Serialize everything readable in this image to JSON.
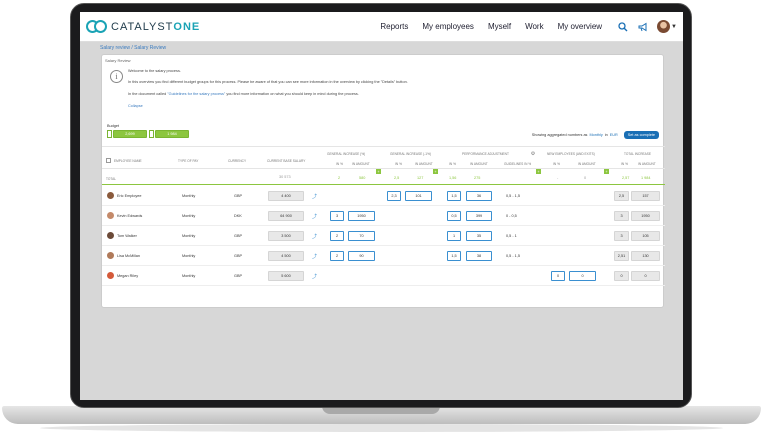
{
  "nav": {
    "brand_a": "CATALYST",
    "brand_b": "ONE",
    "links": [
      "Reports",
      "My employees",
      "Myself",
      "Work",
      "My overview"
    ]
  },
  "breadcrumb": "Salary review / Salary Review",
  "card": {
    "title": "Salary Review",
    "msg1": "Welcome to the salary process.",
    "msg2": "In this overview you find different budget groups for this process. Please be aware of that you can see more information in the overview by clicking the \"Details\" button.",
    "msg3a": "In the document called ",
    "msg3link": "\"Guidelines for the salary process\"",
    "msg3b": " you find more information on what you should keep in mind during the process.",
    "collapse": "Collapse"
  },
  "budget": {
    "label": "Budget",
    "items": [
      "2,699",
      "1 984"
    ]
  },
  "aggregate": {
    "prefix": "Showing aggregated numbers as",
    "period": "Monthly",
    "in": "in",
    "currency": "EUR",
    "button": "Set as complete"
  },
  "columns": {
    "employee": "Employee name",
    "type": "Type of pay",
    "currency": "Currency",
    "base": "Current base salary",
    "general1": "General increase (%)",
    "general2": "General increase (-1%)",
    "performance": "Performance adjustment",
    "newemp": "New employees (and exits)",
    "total": "Total increase",
    "pct": "In %",
    "amount": "In amount",
    "guidelines": "Guidelines in %"
  },
  "totals": {
    "label": "Total",
    "base": "30 573",
    "g1pct": "2",
    "g1amt": "580",
    "g2pct": "2,5",
    "g2amt": "127",
    "perfpct": "1,56",
    "perfamt": "275",
    "newpct": "-",
    "newamt": "0",
    "totpct": "2,57",
    "totamt": "1 984"
  },
  "rows": [
    {
      "name": "Eric Employee",
      "type": "Monthly",
      "currency": "GBP",
      "base": "4 400",
      "g1pct": "",
      "g1amt": "",
      "g2pct": "2,3",
      "g2amt": "101",
      "perfpct": "1,5",
      "perfamt": "36",
      "guide": "0,5 - 1,5",
      "newpct": "",
      "newamt": "",
      "totpct": "2,5",
      "totamt": "157"
    },
    {
      "name": "Kevin Edwards",
      "type": "Monthly",
      "currency": "DKK",
      "base": "64 900",
      "g1pct": "3",
      "g1amt": "1950",
      "g2pct": "",
      "g2amt": "",
      "perfpct": "0,5",
      "perfamt": "399",
      "guide": "0 - 0,5",
      "newpct": "",
      "newamt": "",
      "totpct": "3",
      "totamt": "1950"
    },
    {
      "name": "Tom Walker",
      "type": "Monthly",
      "currency": "GBP",
      "base": "3 500",
      "g1pct": "2",
      "g1amt": "70",
      "g2pct": "",
      "g2amt": "",
      "perfpct": "1",
      "perfamt": "35",
      "guide": "0,5 - 1",
      "newpct": "",
      "newamt": "",
      "totpct": "3",
      "totamt": "105"
    },
    {
      "name": "Lisa McMillan",
      "type": "Monthly",
      "currency": "GBP",
      "base": "4 500",
      "g1pct": "2",
      "g1amt": "90",
      "g2pct": "",
      "g2amt": "",
      "perfpct": "1,5",
      "perfamt": "38",
      "guide": "0,5 - 1,5",
      "newpct": "",
      "newamt": "",
      "totpct": "2,51",
      "totamt": "130"
    },
    {
      "name": "Megan Riley",
      "type": "Monthly",
      "currency": "GBP",
      "base": "5 600",
      "g1pct": "",
      "g1amt": "",
      "g2pct": "",
      "g2amt": "",
      "perfpct": "",
      "perfamt": "",
      "guide": "",
      "newpct": "0",
      "newamt": "0",
      "totpct": "0",
      "totamt": "0"
    }
  ],
  "colors": {
    "accent": "#1a6fb5",
    "brand": "#1aa3b5",
    "green": "#8cc63f"
  }
}
